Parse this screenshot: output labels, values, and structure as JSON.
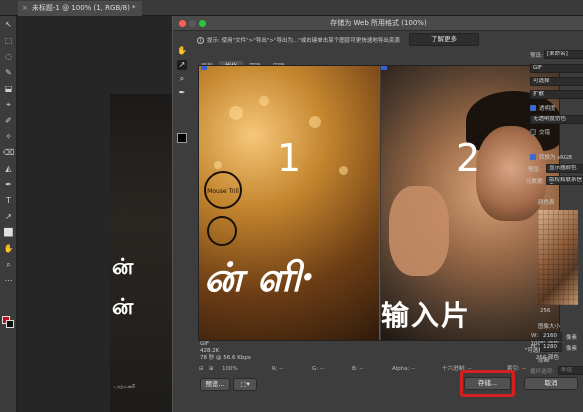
{
  "ps": {
    "tab_title": "未标题-1 @ 100% (1, RGB/8) *",
    "tab_close": "×",
    "tools": [
      "↖",
      "⬚",
      "◌",
      "✎",
      "⬓",
      "⌖",
      "✐",
      "✧",
      "⌫",
      "◭",
      "✒",
      "T",
      "↗",
      "⬜",
      "✋",
      "⌕",
      "⋯"
    ],
    "doc_text": [
      "ன்",
      "ன்"
    ],
    "doc_credit": "பரத்மணி"
  },
  "dialog": {
    "title": "存储为 Web 所用格式 (100%)",
    "hint": "提示: 使用\"文件\">\"导出\">\"导出为...\"或右键单击某个图层可更快速地导出资源",
    "learn_more": "了解更多",
    "tabs": [
      "原稿",
      "优化",
      "双联",
      "四联"
    ],
    "active_tab": "优化",
    "pane1": {
      "number": "1",
      "tamil": "ன் ளி·",
      "stamp": "Mouse Trill"
    },
    "pane2": {
      "number": "2",
      "big_text": "《输入片"
    },
    "info_left": [
      "GIF",
      "428.2K",
      "78 秒 @ 56.6 Kbps"
    ],
    "info_right": [
      "100% 仿色",
      "\"可选择\" 调板",
      "256 颜色"
    ],
    "bottom": {
      "zoom": "100%",
      "r": "R: --",
      "g": "G: --",
      "b": "B: --",
      "alpha": "Alpha: --",
      "hex": "十六进制: --",
      "index": "索引: --"
    },
    "buttons": {
      "preview": "预览...",
      "save": "存储...",
      "cancel": "取消"
    }
  },
  "settings": {
    "preset_label": "预设:",
    "preset_value": "[未命名]",
    "format": "GIF",
    "reduction": "可选择",
    "dither_method": "扩散",
    "transparency": "透明度",
    "matte_label": "无透明度仿色",
    "interlaced": "交错",
    "convert_srgb": "转换为 sRGB",
    "preview_label": "预览:",
    "preview_value": "显示器颜色",
    "metadata_label": "元数据:",
    "metadata_value": "版权和联系信息",
    "color_table": "颜色表",
    "color_count": "256",
    "image_size": "图像大小",
    "w_label": "W:",
    "w_value": "2160",
    "h_label": "H:",
    "h_value": "1280",
    "px": "像素",
    "animation": "动画",
    "loop_label": "循环选项:",
    "loop_value": "永远"
  },
  "colors": {
    "accent": "#3b6ad0",
    "highlight_ring": "#d42020"
  }
}
